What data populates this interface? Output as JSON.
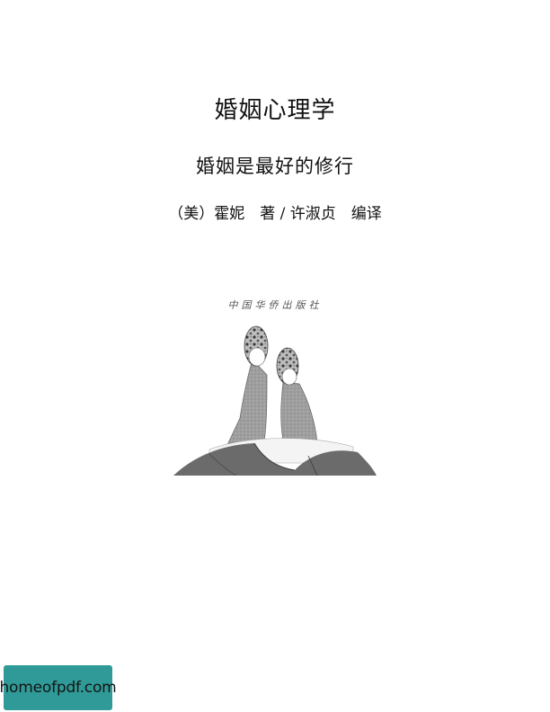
{
  "title": "婚姻心理学",
  "subtitle": "婚姻是最好的修行",
  "author_line": "（美）霍妮　著 / 许淑贞　编译",
  "publisher_mark": "中国华侨出版社",
  "watermark": "homeofpdf.com"
}
